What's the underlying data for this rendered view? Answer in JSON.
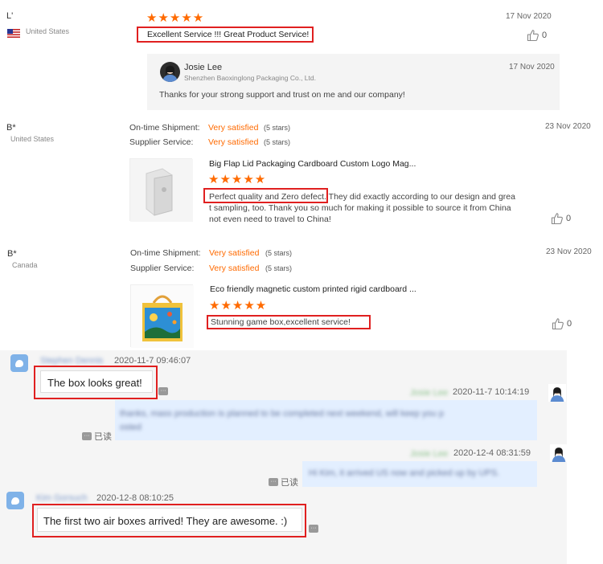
{
  "reviews": [
    {
      "name": "L'",
      "country": "United States",
      "date": "17 Nov 2020",
      "stars": "★★★★★",
      "text": "Excellent Service !!! Great  Product Service!",
      "likes": "0",
      "reply": {
        "name": "Josie Lee",
        "company": "Shenzhen Baoxinglong Packaging Co., Ltd.",
        "date": "17 Nov 2020",
        "text": "Thanks for your strong support and trust on me and our company!"
      }
    },
    {
      "name": "B*",
      "country": "United States",
      "date": "23 Nov 2020",
      "shipment_label": "On-time Shipment:",
      "shipment_value": "Very satisfied",
      "shipment_stars": "(5 stars)",
      "service_label": "Supplier Service:",
      "service_value": "Very satisfied",
      "service_stars": "(5 stars)",
      "product_title": "Big Flap Lid Packaging Cardboard Custom Logo Mag...",
      "stars": "★★★★★",
      "text_highlight": "Perfect quality and Zero defect.",
      "text_rest_1": " They did exactly according to our design and grea",
      "text_rest_2": "t sampling, too. Thank you so much for making it possible to source it from China",
      "text_rest_3": "not even need to travel to China!",
      "likes": "0"
    },
    {
      "name": "B*",
      "country": "Canada",
      "date": "23 Nov 2020",
      "shipment_label": "On-time Shipment:",
      "shipment_value": "Very satisfied",
      "shipment_stars": "(5 stars)",
      "service_label": "Supplier Service:",
      "service_value": "Very satisfied",
      "service_stars": "(5 stars)",
      "product_title": "Eco friendly magnetic custom printed rigid cardboard ...",
      "stars": "★★★★★",
      "text": "Stunning game box,excellent service!",
      "likes": "0"
    }
  ],
  "chat": {
    "m1": {
      "name": "Stephen Dennis",
      "time": "2020-11-7 09:46:07",
      "text": "The box looks great!"
    },
    "m2": {
      "name": "Josie Lee",
      "time": "2020-11-7 10:14:19",
      "text_1": "thanks, mass production is planned to be completed next weekend, will keep you p",
      "text_2": "osted",
      "read": "已读"
    },
    "m3": {
      "name": "Josie Lee",
      "time": "2020-12-4 08:31:59",
      "text": "Hi Kim, it arrived US now and picked up by UPS.",
      "read": "已读"
    },
    "m4": {
      "name": "Kim Gorsuch",
      "time": "2020-12-8 08:10:25",
      "text": "The first two air boxes arrived! They are awesome. :)"
    }
  },
  "colors": {
    "accent": "#ff6a00",
    "highlight": "#e02020",
    "chat_blue": "#e3efff"
  }
}
